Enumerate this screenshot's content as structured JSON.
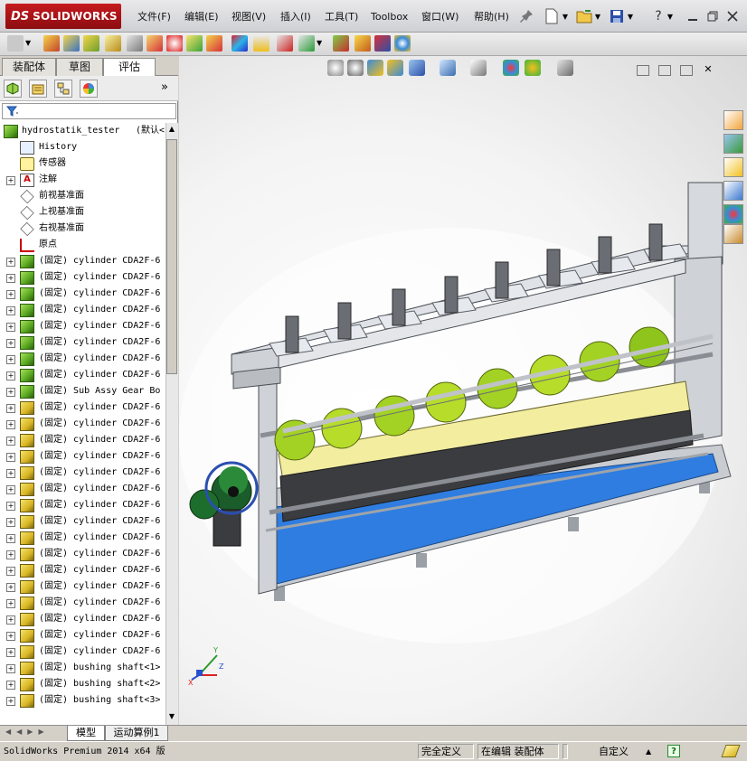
{
  "app": {
    "logo_ds": "DS",
    "logo_name": "SOLIDWORKS"
  },
  "menu": [
    "文件(F)",
    "编辑(E)",
    "视图(V)",
    "插入(I)",
    "工具(T)",
    "Toolbox",
    "窗口(W)",
    "帮助(H)"
  ],
  "left_panel": {
    "tabs": [
      "装配体",
      "草图",
      "评估"
    ],
    "active_tab": "评估",
    "chevron": "»",
    "tree_root": "hydrostatik_tester",
    "tree_root_config": "(默认<",
    "tree_items": [
      {
        "label": "History",
        "icon": "history-icon",
        "expand": false
      },
      {
        "label": "传感器",
        "icon": "sensor-icon",
        "expand": false
      },
      {
        "label": "注解",
        "icon": "annotation-icon",
        "expand": true
      },
      {
        "label": "前视基准面",
        "icon": "plane-icon",
        "expand": false
      },
      {
        "label": "上视基准面",
        "icon": "plane-icon",
        "expand": false
      },
      {
        "label": "右视基准面",
        "icon": "plane-icon",
        "expand": false
      },
      {
        "label": "原点",
        "icon": "origin-icon",
        "expand": false
      },
      {
        "label": "(固定) cylinder CDA2F-6",
        "icon": "assembly-icon",
        "expand": true
      },
      {
        "label": "(固定) cylinder CDA2F-6",
        "icon": "assembly-icon",
        "expand": true
      },
      {
        "label": "(固定) cylinder CDA2F-6",
        "icon": "assembly-icon",
        "expand": true
      },
      {
        "label": "(固定) cylinder CDA2F-6",
        "icon": "assembly-icon",
        "expand": true
      },
      {
        "label": "(固定) cylinder CDA2F-6",
        "icon": "assembly-icon",
        "expand": true
      },
      {
        "label": "(固定) cylinder CDA2F-6",
        "icon": "assembly-icon",
        "expand": true
      },
      {
        "label": "(固定) cylinder CDA2F-6",
        "icon": "assembly-icon",
        "expand": true
      },
      {
        "label": "(固定) cylinder CDA2F-6",
        "icon": "assembly-icon",
        "expand": true
      },
      {
        "label": "(固定) Sub Assy Gear Bo",
        "icon": "assembly-icon",
        "expand": true
      },
      {
        "label": "(固定) cylinder CDA2F-6",
        "icon": "part-icon",
        "expand": true
      },
      {
        "label": "(固定) cylinder CDA2F-6",
        "icon": "part-icon",
        "expand": true
      },
      {
        "label": "(固定) cylinder CDA2F-6",
        "icon": "part-icon",
        "expand": true
      },
      {
        "label": "(固定) cylinder CDA2F-6",
        "icon": "part-icon",
        "expand": true
      },
      {
        "label": "(固定) cylinder CDA2F-6",
        "icon": "part-icon",
        "expand": true
      },
      {
        "label": "(固定) cylinder CDA2F-6",
        "icon": "part-icon",
        "expand": true
      },
      {
        "label": "(固定) cylinder CDA2F-6",
        "icon": "part-icon",
        "expand": true
      },
      {
        "label": "(固定) cylinder CDA2F-6",
        "icon": "part-icon",
        "expand": true
      },
      {
        "label": "(固定) cylinder CDA2F-6",
        "icon": "part-icon",
        "expand": true
      },
      {
        "label": "(固定) cylinder CDA2F-6",
        "icon": "part-icon",
        "expand": true
      },
      {
        "label": "(固定) cylinder CDA2F-6",
        "icon": "part-icon",
        "expand": true
      },
      {
        "label": "(固定) cylinder CDA2F-6",
        "icon": "part-icon",
        "expand": true
      },
      {
        "label": "(固定) cylinder CDA2F-6",
        "icon": "part-icon",
        "expand": true
      },
      {
        "label": "(固定) cylinder CDA2F-6",
        "icon": "part-icon",
        "expand": true
      },
      {
        "label": "(固定) cylinder CDA2F-6",
        "icon": "part-icon",
        "expand": true
      },
      {
        "label": "(固定) cylinder CDA2F-6",
        "icon": "part-icon",
        "expand": true
      },
      {
        "label": "(固定) bushing shaft<1>",
        "icon": "part-icon",
        "expand": true
      },
      {
        "label": "(固定) bushing shaft<2>",
        "icon": "part-icon",
        "expand": true
      },
      {
        "label": "(固定) bushing shaft<3>",
        "icon": "part-icon",
        "expand": true
      }
    ]
  },
  "bottom_tabs": [
    "模型",
    "运动算例1"
  ],
  "status": {
    "app_version": "SolidWorks Premium 2014 x64 版",
    "definition": "完全定义",
    "editing": "在编辑 装配体",
    "units": "自定义",
    "help": "?"
  },
  "colors": {
    "brand_red": "#c51a1f",
    "frame_grey": "#cfd2d6",
    "base_blue": "#2f7de0",
    "tray_yellow": "#f3eda0",
    "cylinder_green": "#a3d224"
  }
}
